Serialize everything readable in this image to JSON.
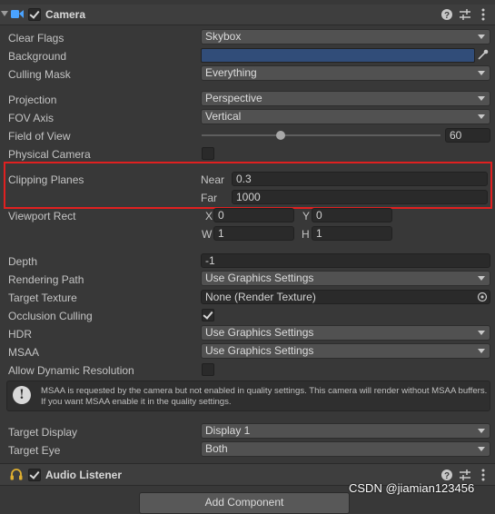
{
  "camera": {
    "title": "Camera",
    "enabled": true
  },
  "labels": {
    "clear_flags": "Clear Flags",
    "background": "Background",
    "culling_mask": "Culling Mask",
    "projection": "Projection",
    "fov_axis": "FOV Axis",
    "field_of_view": "Field of View",
    "physical_camera": "Physical Camera",
    "clipping_planes": "Clipping Planes",
    "viewport_rect": "Viewport Rect",
    "depth": "Depth",
    "rendering_path": "Rendering Path",
    "target_texture": "Target Texture",
    "occlusion_culling": "Occlusion Culling",
    "hdr": "HDR",
    "msaa": "MSAA",
    "allow_dynamic_resolution": "Allow Dynamic Resolution",
    "target_display": "Target Display",
    "target_eye": "Target Eye"
  },
  "values": {
    "clear_flags": "Skybox",
    "background_color": "#314d79",
    "culling_mask": "Everything",
    "projection": "Perspective",
    "fov_axis": "Vertical",
    "field_of_view": "60",
    "field_of_view_fraction": 0.33,
    "physical_camera": false,
    "near_label": "Near",
    "near": "0.3",
    "far_label": "Far",
    "far": "1000",
    "viewport": {
      "x_label": "X",
      "x": "0",
      "y_label": "Y",
      "y": "0",
      "w_label": "W",
      "w": "1",
      "h_label": "H",
      "h": "1"
    },
    "depth": "-1",
    "rendering_path": "Use Graphics Settings",
    "target_texture": "None (Render Texture)",
    "occlusion_culling": true,
    "hdr": "Use Graphics Settings",
    "msaa": "Use Graphics Settings",
    "allow_dynamic_resolution": false,
    "target_display": "Display 1",
    "target_eye": "Both"
  },
  "help": {
    "text": "MSAA is requested by the camera but not enabled in quality settings. This camera will render without MSAA buffers. If you want MSAA enable it in the quality settings."
  },
  "audio_listener": {
    "title": "Audio Listener",
    "enabled": true
  },
  "add_component": "Add Component",
  "watermark": "CSDN @jiamian123456",
  "colors": {
    "highlight_box": "#e02020",
    "background_swatch": "#314d79"
  },
  "icons": {
    "camera": "camera-icon",
    "help": "help-icon",
    "presets": "presets-icon",
    "menu": "kebab-menu-icon",
    "eyedropper": "eyedropper-icon",
    "object_picker": "object-picker-icon",
    "info": "info-icon",
    "headphones": "headphones-icon"
  }
}
